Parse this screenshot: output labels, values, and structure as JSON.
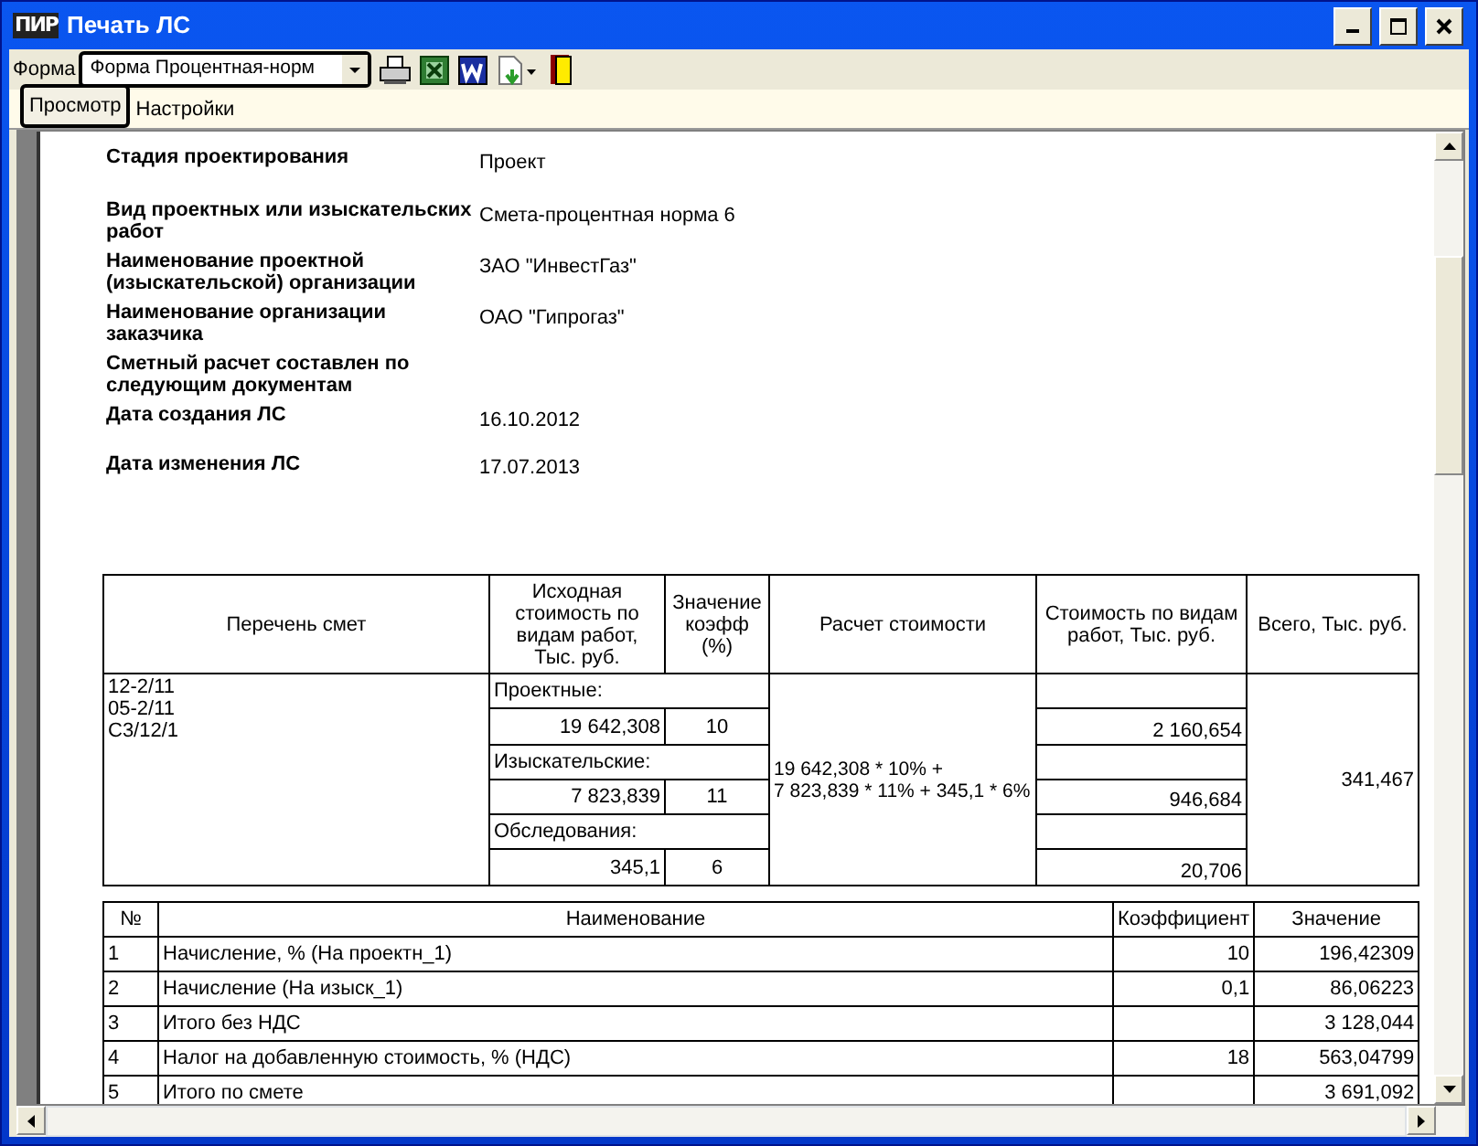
{
  "window": {
    "logo": "ПИР",
    "title": "Печать ЛС"
  },
  "toolbar": {
    "label": "Форма",
    "form_select": {
      "value": "Форма Процентная-норм"
    }
  },
  "tabs": [
    {
      "label": "Просмотр",
      "selected": true
    },
    {
      "label": "Настройки",
      "selected": false
    }
  ],
  "info": [
    {
      "label": "Стадия проектирования",
      "value": "Проект"
    },
    {
      "label": "Вид проектных или изыскательских работ",
      "value": "Смета-процентная норма 6"
    },
    {
      "label": "Наименование проектной (изыскательской) организации",
      "value": "ЗАО \"ИнвестГаз\""
    },
    {
      "label": "Наименование организации заказчика",
      "value": "ОАО \"Гипрогаз\""
    },
    {
      "label": "Сметный расчет составлен по следующим документам"
    },
    {
      "label": "Дата создания ЛС",
      "value": "16.10.2012"
    },
    {
      "label": "Дата изменения ЛС",
      "value": "17.07.2013"
    }
  ],
  "estimate_table": {
    "columns": [
      "Перечень смет",
      "Исходная стоимость по видам работ, Тыс. руб.",
      "Значение коэфф (%)",
      "Расчет стоимости",
      "Стоимость по видам работ, Тыс. руб.",
      "Всего, Тыс. руб."
    ],
    "estimates": [
      "12-2/11",
      "05-2/11",
      "С3/12/1"
    ],
    "groups": [
      {
        "name": "Проектные:",
        "base": "19 642,308",
        "coeff": "10",
        "cost": "2 160,654"
      },
      {
        "name": "Изыскательские:",
        "base": "7 823,839",
        "coeff": "11",
        "cost": "946,684"
      },
      {
        "name": "Обследования:",
        "base": "345,1",
        "coeff": "6",
        "cost": "20,706"
      }
    ],
    "calculation": "19 642,308 * 10% +\n7 823,839 * 11% + 345,1 * 6%",
    "total": "341,467"
  },
  "summary_table": {
    "columns": [
      "№",
      "Наименование",
      "Коэффициент",
      "Значение"
    ],
    "rows": [
      {
        "no": "1",
        "name": "Начисление, % (На проектн_1)",
        "coeff": "10",
        "value": "196,42309"
      },
      {
        "no": "2",
        "name": "Начисление (На изыск_1)",
        "coeff": "0,1",
        "value": "86,06223"
      },
      {
        "no": "3",
        "name": "Итого без НДС",
        "value": "3 128,044"
      },
      {
        "no": "4",
        "name": "Налог на добавленную стоимость, % (НДС)",
        "coeff": "18",
        "value": "563,04799"
      },
      {
        "no": "5",
        "name": "Итого по смете",
        "value": "3 691,092"
      }
    ]
  }
}
